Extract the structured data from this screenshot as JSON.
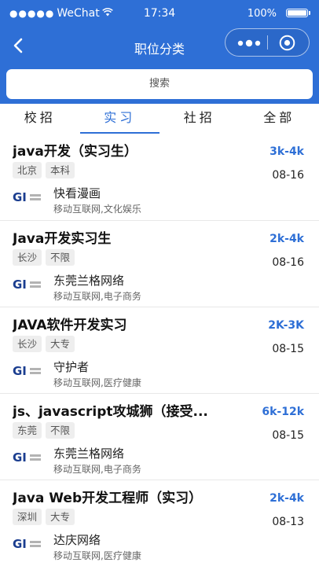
{
  "status_bar": {
    "carrier": "WeChat",
    "time": "17:34",
    "battery": "100%"
  },
  "nav": {
    "title": "职位分类"
  },
  "search": {
    "placeholder": "搜索"
  },
  "tabs": [
    {
      "label": "校招",
      "active": false
    },
    {
      "label": "实习",
      "active": true
    },
    {
      "label": "社招",
      "active": false
    },
    {
      "label": "全部",
      "active": false
    }
  ],
  "jobs": [
    {
      "title": "java开发（实习生）",
      "salary": "3k-4k",
      "date": "08-16",
      "tags": [
        "北京",
        "本科"
      ],
      "company": "快看漫画",
      "industry": "移动互联网,文化娱乐"
    },
    {
      "title": "Java开发实习生",
      "salary": "2k-4k",
      "date": "08-16",
      "tags": [
        "长沙",
        "不限"
      ],
      "company": "东莞兰格网络",
      "industry": "移动互联网,电子商务"
    },
    {
      "title": "JAVA软件开发实习",
      "salary": "2K-3K",
      "date": "08-15",
      "tags": [
        "长沙",
        "大专"
      ],
      "company": "守护者",
      "industry": "移动互联网,医疗健康"
    },
    {
      "title": "js、javascript攻城狮（接受...",
      "salary": "6k-12k",
      "date": "08-15",
      "tags": [
        "东莞",
        "不限"
      ],
      "company": "东莞兰格网络",
      "industry": "移动互联网,电子商务"
    },
    {
      "title": "Java Web开发工程师（实习）",
      "salary": "2k-4k",
      "date": "08-13",
      "tags": [
        "深圳",
        "大专"
      ],
      "company": "达庆网络",
      "industry": "移动互联网,医疗健康"
    }
  ],
  "logo_text": "GI",
  "colors": {
    "brand": "#2e6fd6",
    "tag_bg": "#eeeeee"
  }
}
